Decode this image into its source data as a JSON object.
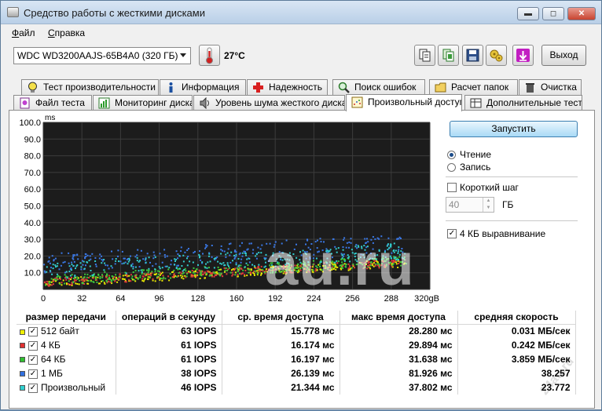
{
  "window": {
    "title": "Средство работы с жесткими дисками",
    "min": "▬",
    "max": "◻",
    "close": "✕"
  },
  "menu": [
    "Файл",
    "Справка"
  ],
  "toolbar": {
    "drive": "WDC WD3200AAJS-65B4A0 (320 ГБ)",
    "temperature": "27°C",
    "exit_label": "Выход",
    "buttons": [
      "copy-icon",
      "copy-all-icon",
      "save-icon",
      "options-icon",
      "download-icon"
    ]
  },
  "tabs_row1": [
    {
      "label": "Тест производительности",
      "icon": "bulb-icon"
    },
    {
      "label": "Информация",
      "icon": "info-icon"
    },
    {
      "label": "Надежность",
      "icon": "plus-icon"
    },
    {
      "label": "Поиск ошибок",
      "icon": "search-icon"
    },
    {
      "label": "Расчет папок",
      "icon": "folder-icon"
    },
    {
      "label": "Очистка",
      "icon": "trash-icon"
    }
  ],
  "tabs_row2": [
    {
      "label": "Файл теста",
      "icon": "file-bulb-icon"
    },
    {
      "label": "Мониторинг диска",
      "icon": "chart-icon"
    },
    {
      "label": "Уровень шума жесткого диска",
      "icon": "speaker-icon"
    },
    {
      "label": "Произвольный доступ",
      "icon": "scatter-icon",
      "active": true
    },
    {
      "label": "Дополнительные тесты",
      "icon": "table-icon"
    }
  ],
  "side": {
    "run_label": "Запустить",
    "read_label": "Чтение",
    "write_label": "Запись",
    "short_stroke_label": "Короткий шаг",
    "size_value": "40",
    "size_unit": "ГБ",
    "align_label": "4 КБ выравнивание"
  },
  "table": {
    "headers": [
      "размер передачи",
      "операций в секунду",
      "ср. время доступа",
      "макс время доступа",
      "средняя скорость"
    ],
    "rows": [
      {
        "name": "512 байт",
        "color": "#f0f000",
        "iops": "63 IOPS",
        "avg": "15.778 мс",
        "max": "28.280 мс",
        "speed": "0.031 МБ/сек"
      },
      {
        "name": "4 КБ",
        "color": "#e03030",
        "iops": "61 IOPS",
        "avg": "16.174 мс",
        "max": "29.894 мс",
        "speed": "0.242 МБ/сек"
      },
      {
        "name": "64 КБ",
        "color": "#30c030",
        "iops": "61 IOPS",
        "avg": "16.197 мс",
        "max": "31.638 мс",
        "speed": "3.859 МБ/сек"
      },
      {
        "name": "1 МБ",
        "color": "#3070e0",
        "iops": "38 IOPS",
        "avg": "26.139 мс",
        "max": "81.926 мс",
        "speed": "38.257"
      },
      {
        "name": "Произвольный",
        "color": "#30d0d0",
        "iops": "46 IOPS",
        "avg": "21.344 мс",
        "max": "37.802 мс",
        "speed": "23.772"
      }
    ]
  },
  "watermark": "au.ru",
  "watermark2": "24au.ru",
  "chart_data": {
    "type": "scatter",
    "ylabel": "ms",
    "xlim": [
      0,
      320
    ],
    "ylim": [
      0,
      100
    ],
    "yticks": [
      "100.0",
      "90.0",
      "80.0",
      "70.0",
      "60.0",
      "50.0",
      "40.0",
      "30.0",
      "20.0",
      "10.0"
    ],
    "xticks": [
      "0",
      "32",
      "64",
      "96",
      "128",
      "160",
      "192",
      "224",
      "256",
      "288",
      "320gB"
    ],
    "series": [
      {
        "name": "512 байт",
        "color": "#e8e800",
        "base_ms_start": 3.5,
        "base_ms_end": 15.5,
        "spread_ms": 5
      },
      {
        "name": "4 КБ",
        "color": "#e03a3a",
        "base_ms_start": 4,
        "base_ms_end": 16,
        "spread_ms": 5
      },
      {
        "name": "64 КБ",
        "color": "#3cc83c",
        "base_ms_start": 5,
        "base_ms_end": 17,
        "spread_ms": 6
      },
      {
        "name": "1 МБ",
        "color": "#3a78e6",
        "base_ms_start": 14,
        "base_ms_end": 26,
        "spread_ms": 12
      },
      {
        "name": "Произвольный",
        "color": "#32cccc",
        "base_ms_start": 10,
        "base_ms_end": 22,
        "spread_ms": 10
      }
    ]
  }
}
